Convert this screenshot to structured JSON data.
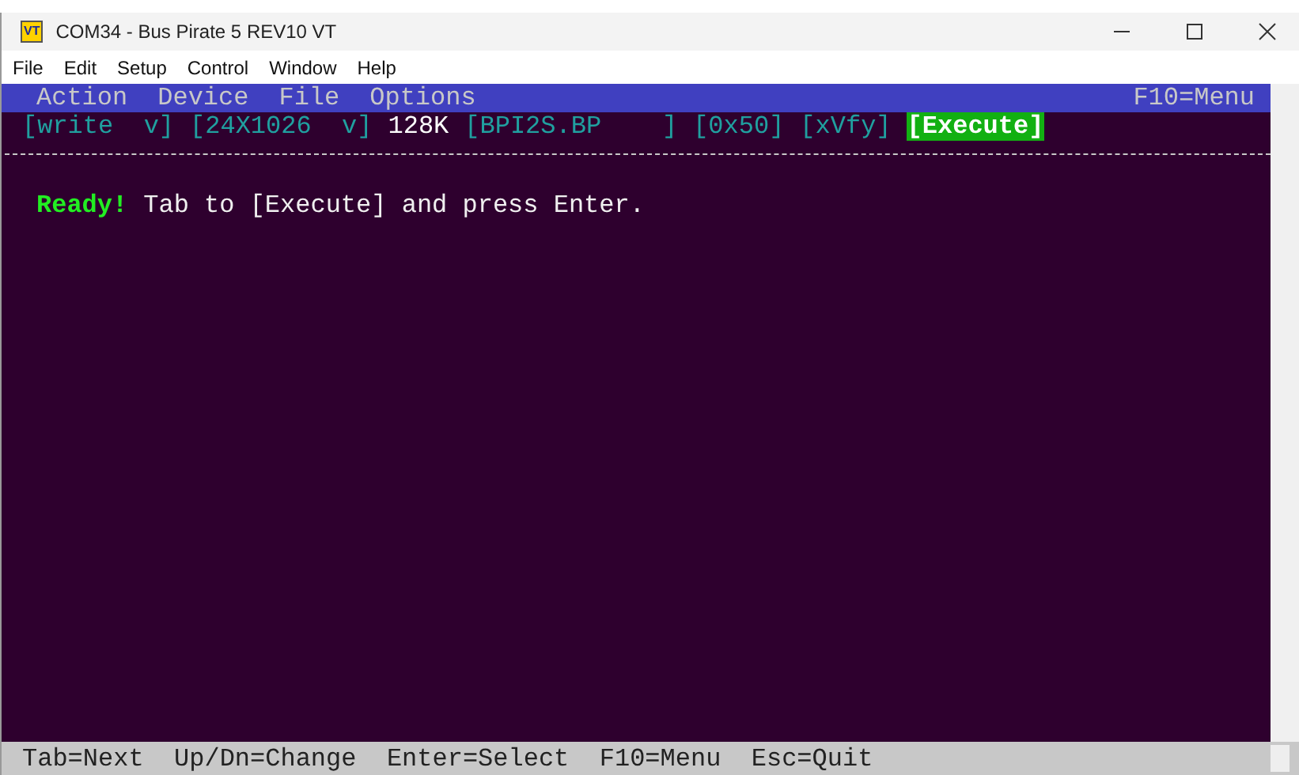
{
  "window": {
    "title": "COM34 - Bus Pirate 5 REV10 VT",
    "app_icon": "VT"
  },
  "menu": [
    "File",
    "Edit",
    "Setup",
    "Control",
    "Window",
    "Help"
  ],
  "terminal": {
    "menu": [
      "Action",
      "Device",
      "File",
      "Options"
    ],
    "menu_hint": "F10=Menu",
    "fields": [
      {
        "kind": "field",
        "text": "[write  v]",
        "selected": false
      },
      {
        "kind": "field",
        "text": "[24X1026  v]",
        "selected": false
      },
      {
        "kind": "text",
        "text": "128K",
        "selected": false
      },
      {
        "kind": "field",
        "text": "[BPI2S.BP    ]",
        "selected": false
      },
      {
        "kind": "field",
        "text": "[0x50]",
        "selected": false
      },
      {
        "kind": "field",
        "text": "[xVfy]",
        "selected": false
      },
      {
        "kind": "button",
        "text": "[Execute]",
        "selected": true
      }
    ],
    "status_label": "Ready!",
    "message": "Tab to [Execute] and press Enter.",
    "status_bar": "Tab=Next  Up/Dn=Change  Enter=Select  F10=Menu  Esc=Quit"
  }
}
